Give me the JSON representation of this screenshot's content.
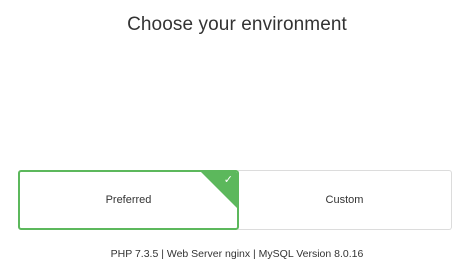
{
  "header": {
    "title": "Choose your environment"
  },
  "options": [
    {
      "label": "Preferred",
      "selected": true
    },
    {
      "label": "Custom",
      "selected": false
    }
  ],
  "footer": {
    "info": "PHP 7.3.5 | Web Server nginx | MySQL Version 8.0.16"
  },
  "icons": {
    "selected_check": "check-icon"
  },
  "colors": {
    "accent": "#5cb85c",
    "border": "#dcdcdc",
    "text": "#333333"
  }
}
